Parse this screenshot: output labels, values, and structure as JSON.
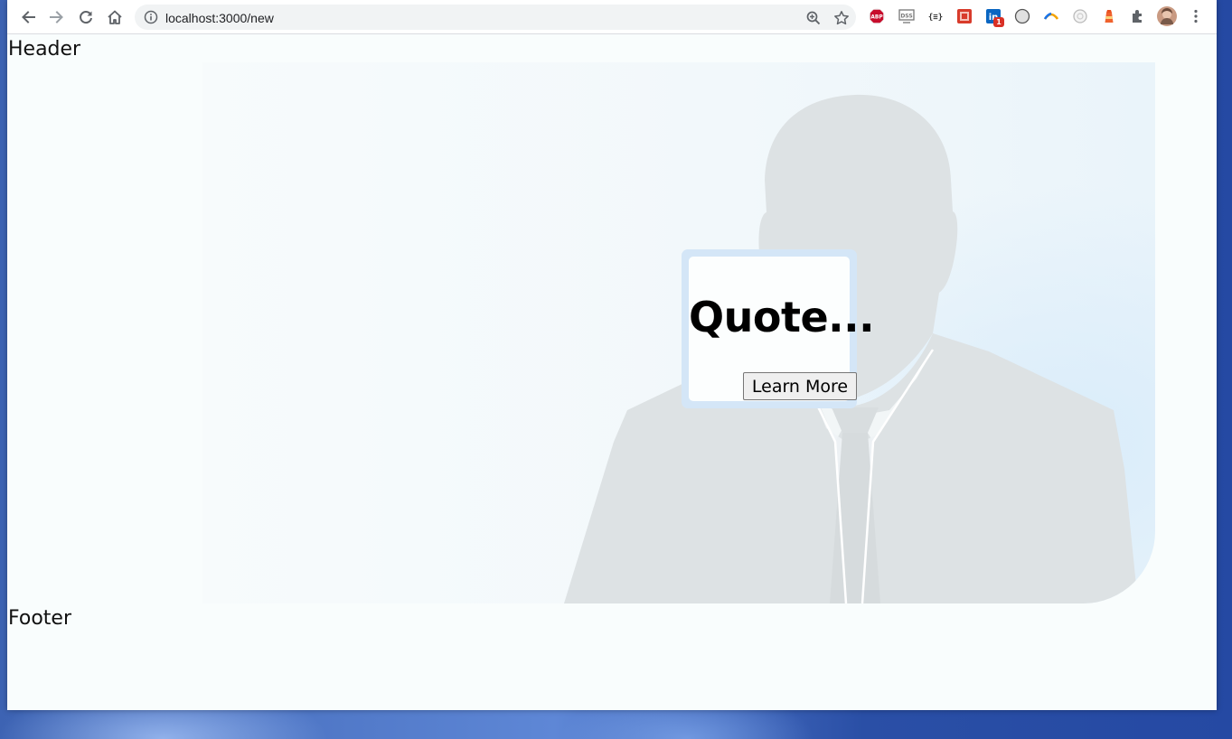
{
  "browser": {
    "url": "localhost:3000/new",
    "extensions": [
      {
        "name": "adblock-plus-icon",
        "label": "ABP",
        "color": "#c70d2c"
      },
      {
        "name": "dss-extension-icon",
        "label": "DSS",
        "color": "#777777"
      },
      {
        "name": "json-viewer-icon",
        "label": "{≡}",
        "color": "#333333"
      },
      {
        "name": "red-extension-icon",
        "label": "",
        "color": "#d83b2b"
      },
      {
        "name": "linkedin-icon",
        "label": "in",
        "color": "#0a66c2",
        "badge": "1"
      },
      {
        "name": "dark-mode-icon",
        "label": "",
        "color": "#555555"
      },
      {
        "name": "colorful-arc-icon",
        "label": "",
        "color": "#f4a300"
      },
      {
        "name": "circle-extension-icon",
        "label": "",
        "color": "#bbbbbb"
      },
      {
        "name": "lighthouse-icon",
        "label": "",
        "color": "#e8501e"
      },
      {
        "name": "extensions-puzzle-icon",
        "label": "",
        "color": "#5f6368"
      }
    ]
  },
  "page": {
    "header": "Header",
    "quote": "Quote...",
    "learn_more": "Learn More",
    "footer": "Footer"
  },
  "colors": {
    "page_bg": "#f9fdfd",
    "card_border": "#d4e6f7",
    "silhouette": "#dde2e4"
  }
}
